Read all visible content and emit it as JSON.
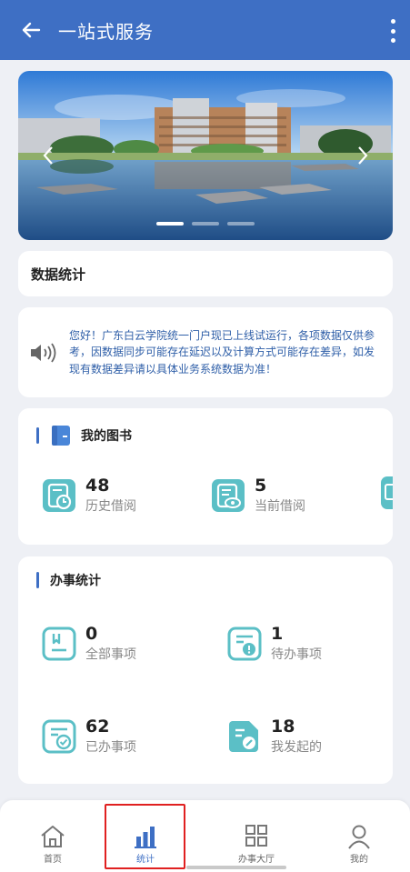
{
  "header": {
    "title": "一站式服务",
    "back_icon": "arrow-left-icon",
    "more_icon": "more-vertical-icon"
  },
  "banner": {
    "slides": 3,
    "active_slide": 1
  },
  "stats_card": {
    "title": "数据统计"
  },
  "notice": {
    "text": "您好！广东白云学院统一门户现已上线试运行，各项数据仅供参考，因数据同步可能存在延迟以及计算方式可能存在差异，如发现有数据差异请以具体业务系统数据为准！"
  },
  "books": {
    "title": "我的图书",
    "items": [
      {
        "value": "48",
        "label": "历史借阅"
      },
      {
        "value": "5",
        "label": "当前借阅"
      }
    ]
  },
  "tasks": {
    "title": "办事统计",
    "items": [
      {
        "value": "0",
        "label": "全部事项"
      },
      {
        "value": "1",
        "label": "待办事项"
      },
      {
        "value": "62",
        "label": "已办事项"
      },
      {
        "value": "18",
        "label": "我发起的"
      }
    ]
  },
  "tabbar": {
    "items": [
      {
        "label": "首页",
        "icon": "home-icon"
      },
      {
        "label": "统计",
        "icon": "bar-chart-icon"
      },
      {
        "label": "办事大厅",
        "icon": "grid-icon"
      },
      {
        "label": "我的",
        "icon": "user-icon"
      }
    ],
    "active": 1
  },
  "colors": {
    "primary": "#3e6fc4",
    "icon_teal": "#5bbfc6",
    "notice_text": "#2f5fa8",
    "highlight": "#e02020"
  }
}
